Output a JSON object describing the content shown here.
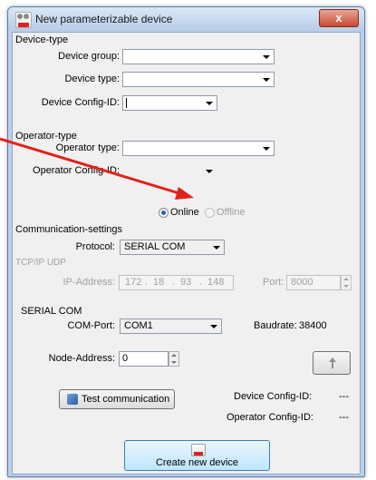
{
  "window": {
    "title": "New parameterizable device",
    "close_glyph": "x"
  },
  "device_type": {
    "section": "Device-type",
    "group_label": "Device group:",
    "type_label": "Device type:",
    "config_label": "Device Config-ID:"
  },
  "operator_type": {
    "section": "Operator-type",
    "type_label": "Operator type:",
    "config_label": "Operator Config-ID:"
  },
  "mode": {
    "online": "Online",
    "offline": "Offline",
    "selected": "online"
  },
  "communication": {
    "section": "Communication-settings",
    "protocol_label": "Protocol:",
    "protocol_value": "SERIAL COM",
    "tcp_section": "TCP/IP UDP",
    "ip_label": "IP-Address:",
    "ip": [
      "172",
      "18",
      "93",
      "148"
    ],
    "port_label": "Port:",
    "port_value": "8000",
    "serial_section": "SERIAL COM",
    "com_label": "COM-Port:",
    "com_value": "COM1",
    "baud_label": "Baudrate:",
    "baud_value": "38400",
    "node_label": "Node-Address:",
    "node_value": "0"
  },
  "test": {
    "button": "Test communication",
    "device_config_label": "Device Config-ID:",
    "device_config_value": "---",
    "operator_config_label": "Operator Config-ID:",
    "operator_config_value": "---"
  },
  "create_button": "Create new device",
  "annotation_color": "#e0231a"
}
